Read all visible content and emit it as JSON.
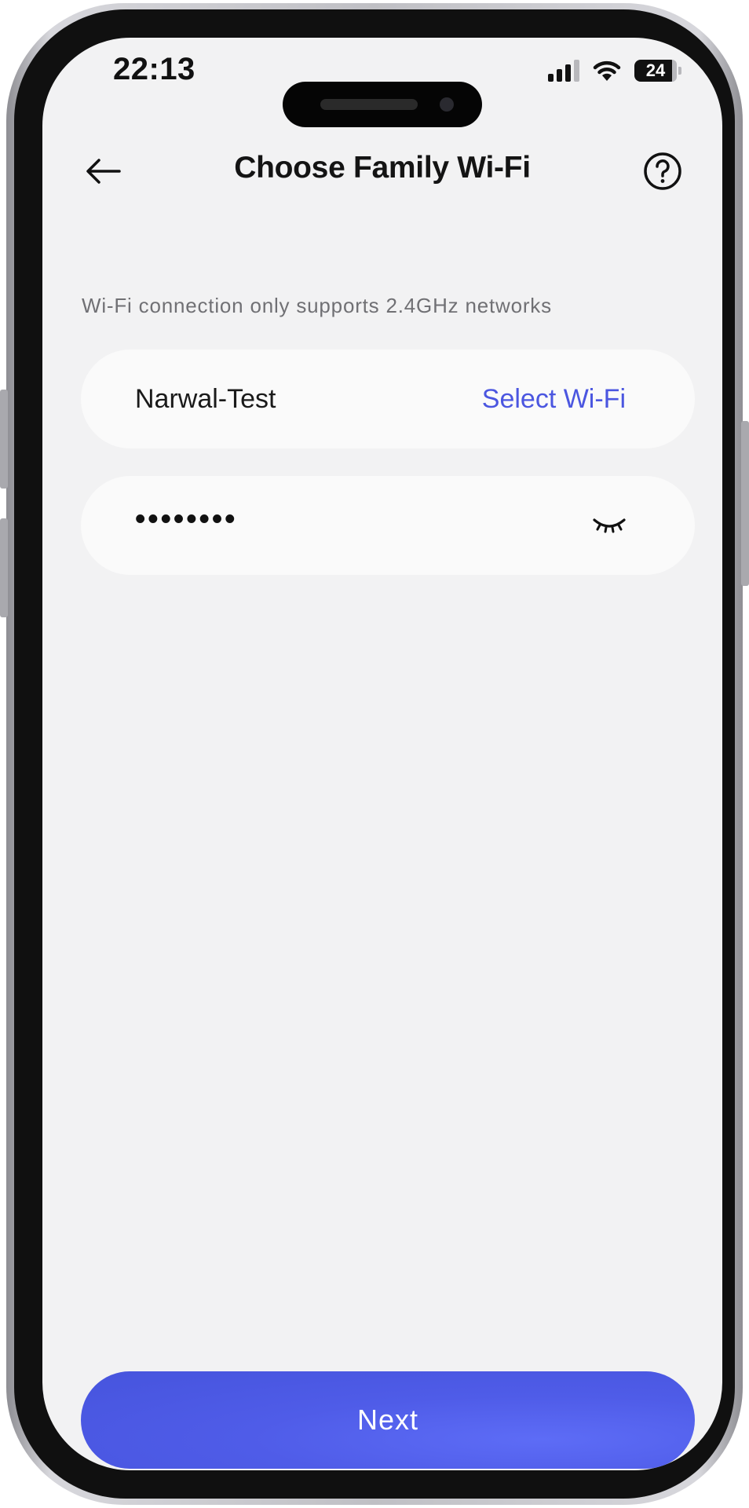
{
  "status_bar": {
    "time": "22:13",
    "battery": "24",
    "signal_icon": "cellular-signal-icon",
    "wifi_icon": "wifi-icon"
  },
  "header": {
    "title": "Choose Family Wi-Fi",
    "back_icon": "arrow-left-icon",
    "help_icon": "question-circle-icon"
  },
  "main": {
    "hint": "Wi-Fi connection only supports 2.4GHz networks",
    "wifi": {
      "name": "Narwal-Test",
      "select_label": "Select Wi-Fi"
    },
    "password": {
      "masked_value": "••••••••",
      "visibility_icon": "eye-closed-icon"
    }
  },
  "footer": {
    "next_label": "Next"
  },
  "colors": {
    "accent": "#4B56E0",
    "background": "#F2F2F3",
    "field_background": "#FAFAFA"
  }
}
